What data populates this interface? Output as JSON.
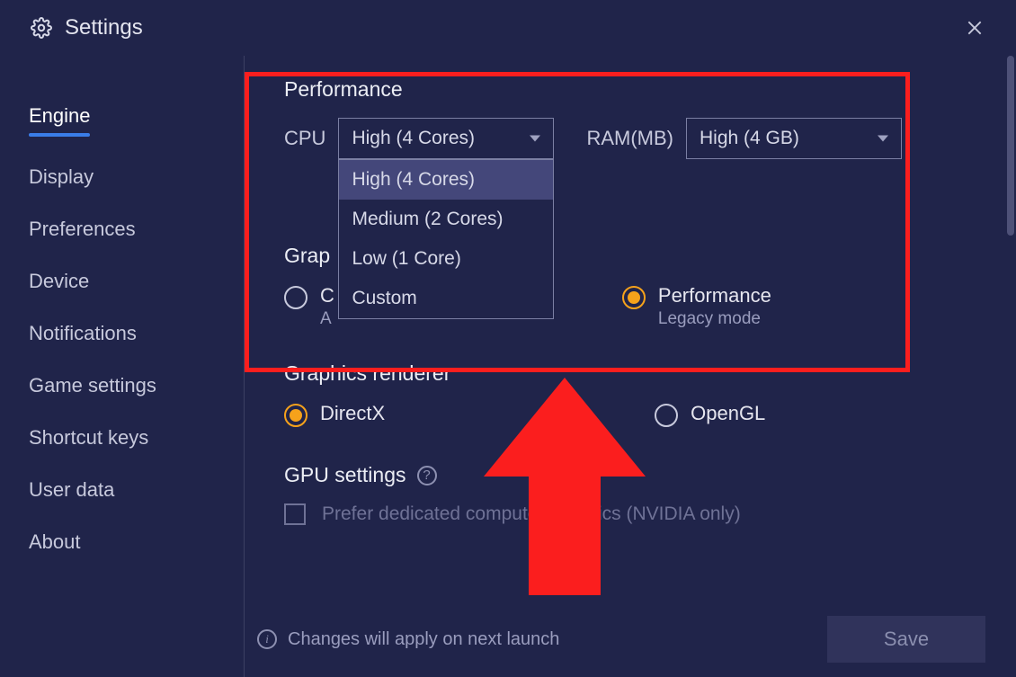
{
  "header": {
    "title": "Settings"
  },
  "sidebar": {
    "items": [
      {
        "label": "Engine",
        "active": true
      },
      {
        "label": "Display"
      },
      {
        "label": "Preferences"
      },
      {
        "label": "Device"
      },
      {
        "label": "Notifications"
      },
      {
        "label": "Game settings"
      },
      {
        "label": "Shortcut keys"
      },
      {
        "label": "User data"
      },
      {
        "label": "About"
      }
    ]
  },
  "performance": {
    "title": "Performance",
    "cpu_label": "CPU",
    "cpu_value": "High (4 Cores)",
    "cpu_options": [
      "High (4 Cores)",
      "Medium (2 Cores)",
      "Low (1 Core)",
      "Custom"
    ],
    "ram_label": "RAM(MB)",
    "ram_value": "High (4 GB)"
  },
  "graphics_engine": {
    "title_partial": "Grap",
    "opt1_visible_letter": "C",
    "opt1_sub_visible_letter": "A",
    "opt2_label": "Performance",
    "opt2_sub": "Legacy mode"
  },
  "renderer": {
    "title": "Graphics renderer",
    "opt1": "DirectX",
    "opt2": "OpenGL"
  },
  "gpu": {
    "title": "GPU settings",
    "checkbox_label": "Prefer dedicated computer graphics (NVIDIA only)"
  },
  "footer": {
    "info_text": "Changes will apply on next launch",
    "save_label": "Save"
  },
  "colors": {
    "accent_blue": "#3a7de8",
    "radio_orange": "#f6a21b",
    "annotation_red": "#fb1e1e",
    "bg": "#20244a"
  }
}
